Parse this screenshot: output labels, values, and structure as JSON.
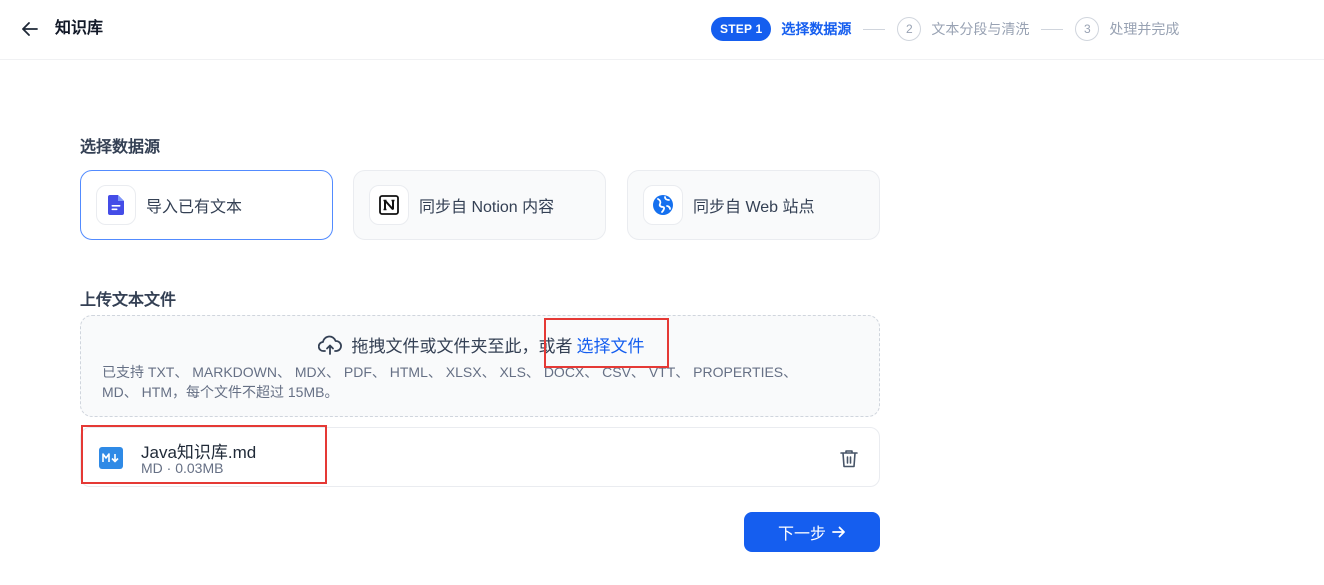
{
  "header": {
    "title": "知识库",
    "back_icon": "arrow-left-icon"
  },
  "stepper": {
    "step1_pill": "STEP 1",
    "step1_label": "选择数据源",
    "step2_num": "2",
    "step2_label": "文本分段与清洗",
    "step3_num": "3",
    "step3_label": "处理并完成",
    "active_color": "#155eef"
  },
  "data_source": {
    "title": "选择数据源",
    "options": [
      {
        "label": "导入已有文本",
        "icon": "document-icon",
        "selected": true
      },
      {
        "label": "同步自 Notion 内容",
        "icon": "notion-icon",
        "selected": false
      },
      {
        "label": "同步自 Web 站点",
        "icon": "web-globe-icon",
        "selected": false
      }
    ]
  },
  "upload": {
    "title": "上传文本文件",
    "drop_text": "拖拽文件或文件夹至此，或者",
    "choose_link": "选择文件",
    "hint_line1": "已支持 TXT、 MARKDOWN、 MDX、 PDF、 HTML、 XLSX、 XLS、 DOCX、 CSV、 VTT、 PROPERTIES、",
    "hint_line2": "MD、 HTM，每个文件不超过 15MB。"
  },
  "files": [
    {
      "name": "Java知识库.md",
      "meta": "MD · 0.03MB",
      "icon": "markdown-icon"
    }
  ],
  "actions": {
    "next_label": "下一步"
  },
  "annotation_color": "#e53935"
}
